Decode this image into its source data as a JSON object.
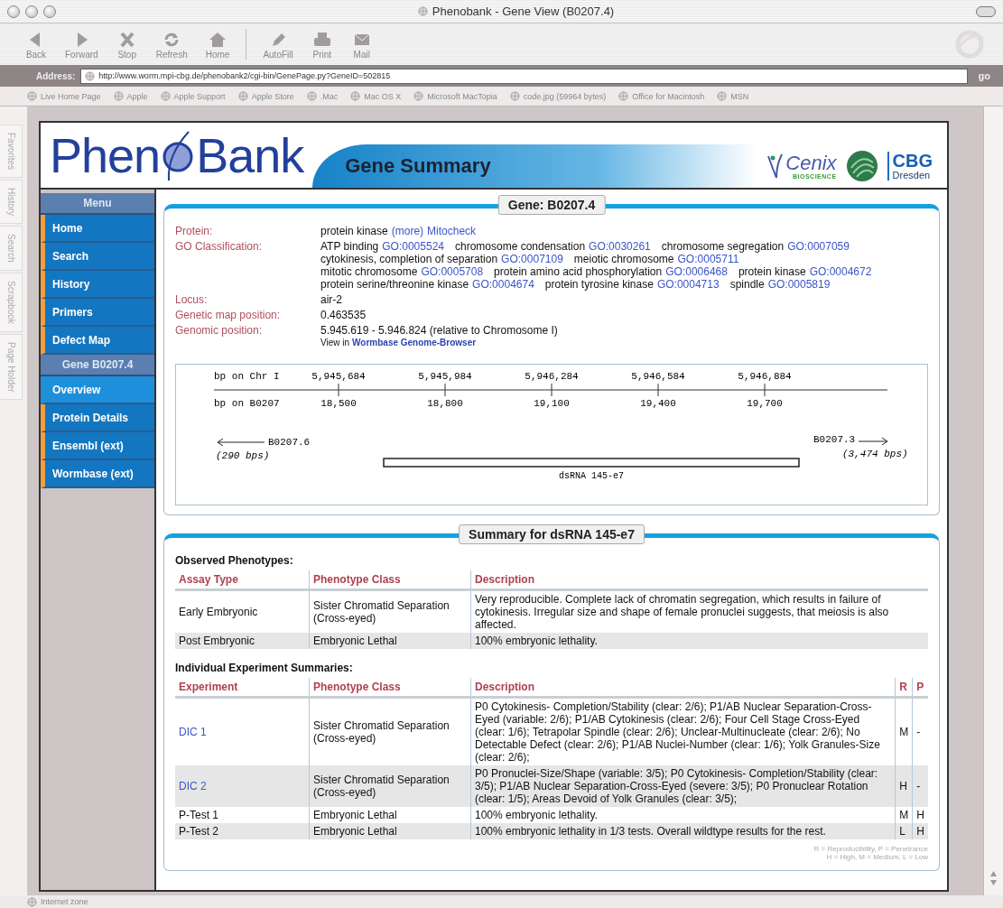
{
  "window": {
    "title": "Phenobank - Gene View (B0207.4)"
  },
  "toolbar": {
    "navigation": [
      {
        "label": "Back",
        "kind": "back"
      },
      {
        "label": "Forward",
        "kind": "forward"
      },
      {
        "label": "Stop",
        "kind": "stop"
      },
      {
        "label": "Refresh",
        "kind": "refresh"
      },
      {
        "label": "Home",
        "kind": "home"
      }
    ],
    "tools": [
      {
        "label": "AutoFill",
        "kind": "autofill"
      },
      {
        "label": "Print",
        "kind": "print"
      },
      {
        "label": "Mail",
        "kind": "mail"
      }
    ]
  },
  "address_bar": {
    "label": "Address:",
    "value": "http://www.worm.mpi-cbg.de/phenobank2/cgi-bin/GenePage.py?GeneID=502815",
    "go": "go"
  },
  "favorites_bar": [
    "Live Home Page",
    "Apple",
    "Apple Support",
    "Apple Store",
    ".Mac",
    "Mac OS X",
    "Microsoft MacTopia",
    "code.jpg (59964 bytes)",
    "Office for Macintosh",
    "MSN"
  ],
  "explorer_tabs": [
    "Favorites",
    "History",
    "Search",
    "Scrapbook",
    "Page Holder"
  ],
  "page": {
    "logo": {
      "left": "Phen",
      "right": "Bank"
    },
    "banner_title": "Gene Summary",
    "partner_logos": {
      "cenix": "Cenix",
      "cenix_sub": "BIOSCIENCE",
      "cbg": "CBG",
      "cbg_sub": "Dresden"
    },
    "menu": {
      "title": "Menu",
      "items": [
        {
          "label": "Home",
          "selected": false
        },
        {
          "label": "Search",
          "selected": false
        },
        {
          "label": "History",
          "selected": false
        },
        {
          "label": "Primers",
          "selected": false
        },
        {
          "label": "Defect Map",
          "selected": false
        }
      ],
      "gene_title": "Gene B0207.4",
      "gene_items": [
        {
          "label": "Overview",
          "selected": true
        },
        {
          "label": "Protein Details",
          "selected": false
        },
        {
          "label": "Ensembl (ext)",
          "selected": false
        },
        {
          "label": "Wormbase (ext)",
          "selected": false
        }
      ]
    },
    "gene_panel": {
      "title": "Gene: B0207.4",
      "protein": {
        "label": "Protein:",
        "value": "protein kinase",
        "more": "(more)",
        "link": "Mitocheck"
      },
      "go": {
        "label": "GO Classification:",
        "lines": [
          [
            {
              "term": "ATP binding",
              "id": "GO:0005524"
            },
            {
              "term": "chromosome condensation",
              "id": "GO:0030261"
            },
            {
              "term": "chromosome segregation",
              "id": "GO:0007059"
            }
          ],
          [
            {
              "term": "cytokinesis, completion of separation",
              "id": "GO:0007109"
            },
            {
              "term": "meiotic chromosome",
              "id": "GO:0005711"
            }
          ],
          [
            {
              "term": "mitotic chromosome",
              "id": "GO:0005708"
            },
            {
              "term": "protein amino acid phosphorylation",
              "id": "GO:0006468"
            },
            {
              "term": "protein kinase",
              "id": "GO:0004672"
            }
          ],
          [
            {
              "term": "protein serine/threonine kinase",
              "id": "GO:0004674"
            },
            {
              "term": "protein tyrosine kinase",
              "id": "GO:0004713"
            },
            {
              "term": "spindle",
              "id": "GO:0005819"
            }
          ]
        ]
      },
      "fields": [
        {
          "label": "Locus:",
          "value": "air-2"
        },
        {
          "label": "Genetic map position:",
          "value": "0.463535"
        }
      ],
      "genomic": {
        "label": "Genomic position:",
        "value": "5.945.619 - 5.946.824 (relative to Chromosome I)",
        "note": "View in",
        "link": "Wormbase Genome-Browser"
      },
      "map": {
        "chr_label": "bp on Chr I",
        "gene_label": "bp on B0207",
        "ticks": [
          {
            "chr": "5,945,684",
            "gene": "18,500"
          },
          {
            "chr": "5,945,984",
            "gene": "18,800"
          },
          {
            "chr": "5,946,284",
            "gene": "19,100"
          },
          {
            "chr": "5,946,584",
            "gene": "19,400"
          },
          {
            "chr": "5,946,884",
            "gene": "19,700"
          }
        ],
        "left_gene": {
          "name": "B0207.6",
          "length": "(290 bps)"
        },
        "right_gene": {
          "name": "B0207.3",
          "length": "(3,474 bps)"
        },
        "dsrna": "dsRNA 145-e7"
      }
    },
    "summary_panel": {
      "title": "Summary for dsRNA 145-e7",
      "observed": {
        "heading": "Observed Phenotypes:",
        "columns": [
          "Assay Type",
          "Phenotype Class",
          "Description"
        ],
        "rows": [
          {
            "cells": [
              "Early Embryonic",
              "Sister Chromatid Separation (Cross-eyed)",
              "Very reproducible. Complete lack of chromatin segregation, which results in failure of cytokinesis. Irregular size and shape of female pronuclei suggests, that meiosis is also affected."
            ]
          },
          {
            "cells": [
              "Post Embryonic",
              "Embryonic Lethal",
              "100% embryonic lethality."
            ]
          }
        ]
      },
      "experiments": {
        "heading": "Individual Experiment Summaries:",
        "columns": [
          "Experiment",
          "Phenotype Class",
          "Description",
          "R",
          "P"
        ],
        "rows": [
          {
            "linked": true,
            "cells": [
              "DIC 1",
              "Sister Chromatid Separation (Cross-eyed)",
              "P0 Cytokinesis- Completion/Stability (clear: 2/6); P1/AB Nuclear Separation-Cross-Eyed (variable: 2/6); P1/AB Cytokinesis (clear: 2/6); Four Cell Stage Cross-Eyed (clear: 1/6); Tetrapolar Spindle (clear: 2/6); Unclear-Multinucleate (clear: 2/6); No Detectable Defect (clear: 2/6); P1/AB Nuclei-Number (clear: 1/6); Yolk Granules-Size (clear: 2/6);",
              "M",
              "-"
            ]
          },
          {
            "linked": true,
            "cells": [
              "DIC 2",
              "Sister Chromatid Separation (Cross-eyed)",
              "P0 Pronuclei-Size/Shape (variable: 3/5); P0 Cytokinesis- Completion/Stability (clear: 3/5); P1/AB Nuclear Separation-Cross-Eyed (severe: 3/5); P0 Pronuclear Rotation (clear: 1/5); Areas Devoid of Yolk Granules (clear: 3/5);",
              "H",
              "-"
            ]
          },
          {
            "linked": false,
            "cells": [
              "P-Test 1",
              "Embryonic Lethal",
              "100% embryonic lethality.",
              "M",
              "H"
            ]
          },
          {
            "linked": false,
            "cells": [
              "P-Test 2",
              "Embryonic Lethal",
              "100% embryonic lethality in 1/3 tests. Overall wildtype results for the rest.",
              "L",
              "H"
            ]
          }
        ]
      },
      "legend": [
        "R = Reproducibility, P = Penetrance",
        "H = High, M = Medium, L = Low"
      ]
    }
  },
  "status_bar": "Internet zone"
}
